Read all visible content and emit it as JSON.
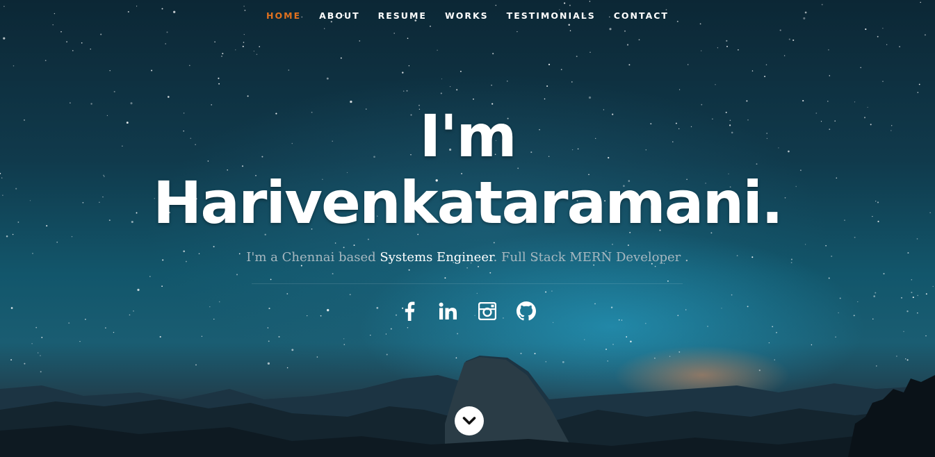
{
  "nav": {
    "items": [
      {
        "label": "HOME",
        "active": true
      },
      {
        "label": "ABOUT"
      },
      {
        "label": "RESUME"
      },
      {
        "label": "WORKS"
      },
      {
        "label": "TESTIMONIALS"
      },
      {
        "label": "CONTACT"
      }
    ]
  },
  "hero": {
    "line1": "I'm",
    "line2": "Harivenkataramani.",
    "tagline": {
      "prefix": "I'm a Chennai based ",
      "highlight": "Systems Engineer",
      "suffix": ". Full Stack MERN Developer ."
    }
  },
  "social": {
    "icons": [
      "facebook-icon",
      "linkedin-icon",
      "instagram-icon",
      "github-icon"
    ]
  },
  "scroll": {
    "icon": "chevron-down-icon"
  },
  "colors": {
    "accent": "#e0711f",
    "text": "#ffffff",
    "muted_text": "#a7b8c0"
  }
}
